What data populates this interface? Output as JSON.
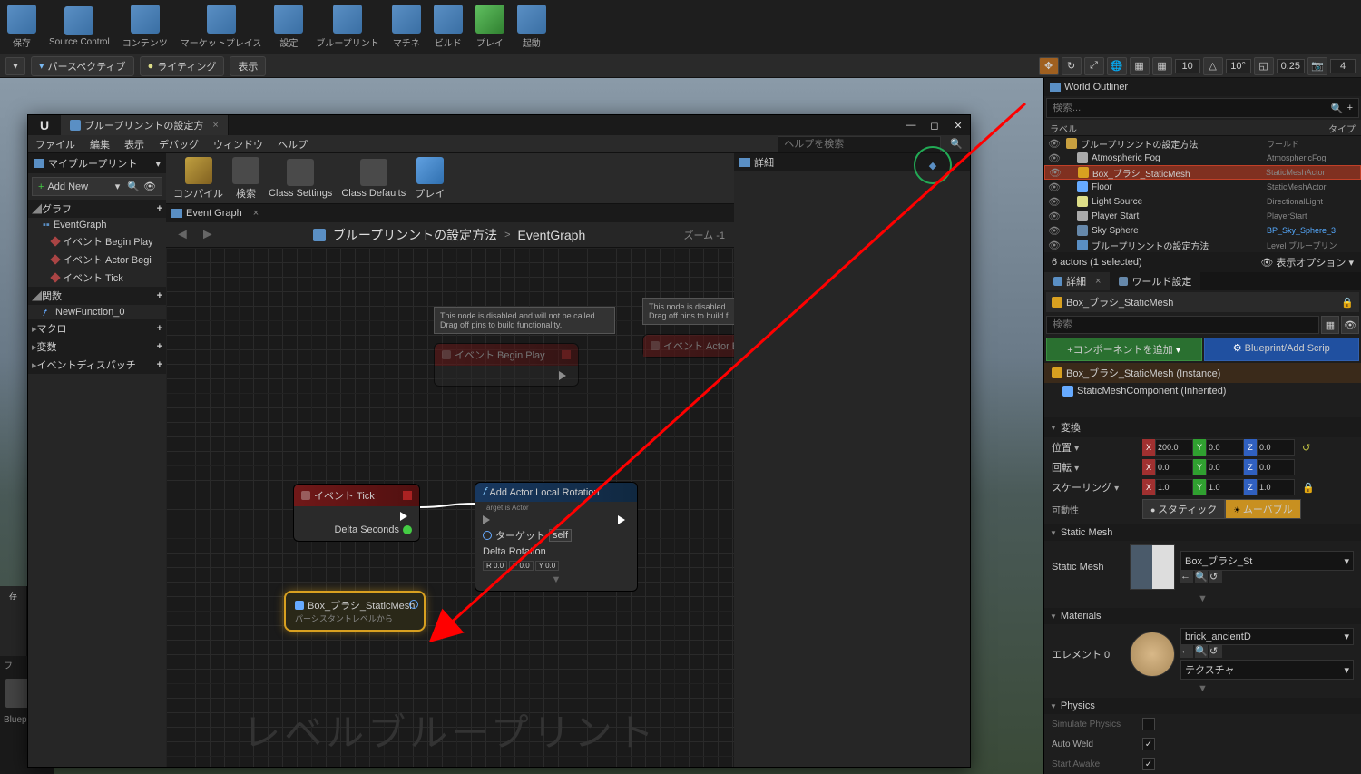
{
  "top_toolbar": {
    "save": "保存",
    "source_control": "Source Control",
    "content": "コンテンツ",
    "marketplace": "マーケットプレイス",
    "settings": "設定",
    "blueprints": "ブループリント",
    "matinee": "マチネ",
    "build": "ビルド",
    "play": "プレイ",
    "launch": "起動"
  },
  "viewport_toolbar": {
    "perspective": "パースペクティブ",
    "lighting": "ライティング",
    "show": "表示",
    "snap1": "10",
    "snap2": "10°",
    "snap3": "0.25",
    "cam": "4"
  },
  "bp_window": {
    "tab_title": "ブループリンントの設定方",
    "menu": {
      "file": "ファイル",
      "edit": "編集",
      "view": "表示",
      "debug": "デバッグ",
      "window": "ウィンドウ",
      "help": "ヘルプ"
    },
    "help_placeholder": "ヘルプを検索",
    "my_bp_tab": "マイブループリント",
    "add_new": "Add New",
    "sections": {
      "graph": "グラフ",
      "funcs": "関数",
      "macros": "マクロ",
      "vars": "変数",
      "dispatch": "イベントディスパッチ"
    },
    "graph_items": {
      "eventgraph": "EventGraph",
      "beginplay": "イベント Begin Play",
      "actorbegin": "イベント Actor Begi",
      "tick": "イベント Tick"
    },
    "func_item": "NewFunction_0",
    "toolbar": {
      "compile": "コンパイル",
      "search": "検索",
      "class_settings": "Class Settings",
      "class_defaults": "Class Defaults",
      "play": "プレイ"
    },
    "graph_tab": "Event Graph",
    "breadcrumb": {
      "root": "ブループリンントの設定方法",
      "leaf": "EventGraph",
      "zoom": "ズーム -1"
    },
    "detail_tab": "詳細",
    "watermark": "レベルブループリント",
    "tooltip_disabled": "This node is disabled and will not be called. Drag off pins to build functionality.",
    "tooltip_disabled2": "This node is disabled. Drag off pins to build f",
    "nodes": {
      "beginplay_title": "イベント Begin Play",
      "actor_title": "イベント Actor B",
      "tick_title": "イベント Tick",
      "tick_delta": "Delta Seconds",
      "rotation_title": "Add Actor Local Rotation",
      "rotation_sub": "Target is Actor",
      "rotation_target": "ターゲット",
      "rotation_self": "self",
      "rotation_delta": "Delta Rotation",
      "rotation_r": "R 0.0",
      "rotation_p": "P 0.0",
      "rotation_y": "Y 0.0",
      "var_title": "Box_ブラシ_StaticMesh",
      "var_sub": "パーシスタントレベルから"
    }
  },
  "outliner": {
    "title": "World Outliner",
    "search_placeholder": "検索...",
    "col_label": "ラベル",
    "col_type": "タイプ",
    "rows": [
      {
        "label": "ブループリンントの設定方法",
        "type": "ワールド",
        "indent": 0,
        "ico": "#c8a040"
      },
      {
        "label": "Atmospheric Fog",
        "type": "AtmosphericFog",
        "indent": 1,
        "ico": "#aaa"
      },
      {
        "label": "Box_ブラシ_StaticMesh",
        "type": "StaticMeshActor",
        "indent": 1,
        "ico": "#d8a020",
        "sel": true
      },
      {
        "label": "Floor",
        "type": "StaticMeshActor",
        "indent": 1,
        "ico": "#6af"
      },
      {
        "label": "Light Source",
        "type": "DirectionalLight",
        "indent": 1,
        "ico": "#dd8"
      },
      {
        "label": "Player Start",
        "type": "PlayerStart",
        "indent": 1,
        "ico": "#aaa"
      },
      {
        "label": "Sky Sphere",
        "type": "BP_Sky_Sphere_3",
        "indent": 1,
        "ico": "#68a",
        "link": true
      },
      {
        "label": "ブループリンントの設定方法",
        "type": "Level ブループリン",
        "indent": 1,
        "ico": "#5a8fc4"
      }
    ],
    "footer_count": "6 actors (1 selected)",
    "footer_view": "表示オプション"
  },
  "details": {
    "tab_detail": "詳細",
    "tab_world": "ワールド設定",
    "actor_name": "Box_ブラシ_StaticMesh",
    "search_placeholder": "検索",
    "btn_add": "+コンポーネントを追加 ",
    "btn_bp": "Blueprint/Add Scrip",
    "comp_root": "Box_ブラシ_StaticMesh (Instance)",
    "comp_child": "StaticMeshComponent (Inherited)",
    "cat_transform": "変換",
    "prop_location": "位置 ",
    "prop_rotation": "回転 ",
    "prop_scale": "スケーリング ",
    "prop_mobility": "可動性",
    "loc": {
      "x": "200.0",
      "y": "0.0",
      "z": "0.0"
    },
    "rot": {
      "x": "0.0",
      "y": "0.0",
      "z": "0.0"
    },
    "scl": {
      "x": "1.0",
      "y": "1.0",
      "z": "1.0"
    },
    "mob_static": "スタティック",
    "mob_movable": "ムーバブル",
    "cat_staticmesh": "Static Mesh",
    "sm_label": "Static Mesh",
    "sm_asset": "Box_ブラシ_St",
    "cat_materials": "Materials",
    "mat_label": "エレメント 0",
    "mat_asset": "brick_ancientD",
    "mat_tex": "テクスチャ",
    "cat_physics": "Physics",
    "phys_sim": "Simulate Physics",
    "phys_weld": "Auto Weld",
    "phys_awake": "Start Awake"
  },
  "bottom": {
    "filter": "フ",
    "save": "存",
    "bluep": "Bluep"
  }
}
